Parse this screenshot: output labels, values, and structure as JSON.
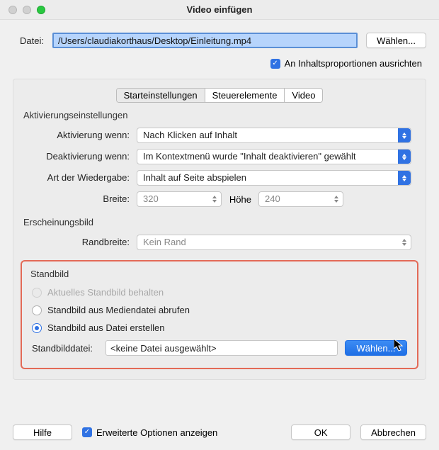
{
  "window": {
    "title": "Video einfügen"
  },
  "file": {
    "label": "Datei:",
    "path": "/Users/claudiakorthaus/Desktop/Einleitung.mp4",
    "choose": "Wählen..."
  },
  "aspect": {
    "label": "An Inhaltsproportionen ausrichten"
  },
  "tabs": {
    "t1": "Starteinstellungen",
    "t2": "Steuerelemente",
    "t3": "Video"
  },
  "activation": {
    "section": "Aktivierungseinstellungen",
    "activate": {
      "label": "Aktivierung wenn:",
      "value": "Nach Klicken auf Inhalt"
    },
    "deactivate": {
      "label": "Deaktivierung wenn:",
      "value": "Im Kontextmenü wurde \"Inhalt deaktivieren\" gewählt"
    },
    "playback": {
      "label": "Art der Wiedergabe:",
      "value": "Inhalt auf Seite abspielen"
    },
    "width": {
      "label": "Breite:",
      "value": "320"
    },
    "height": {
      "label": "Höhe",
      "value": "240"
    }
  },
  "appearance": {
    "section": "Erscheinungsbild",
    "border": {
      "label": "Randbreite:",
      "value": "Kein Rand"
    }
  },
  "poster": {
    "section": "Standbild",
    "opt1": "Aktuelles Standbild behalten",
    "opt2": "Standbild aus Mediendatei abrufen",
    "opt3": "Standbild aus Datei erstellen",
    "fileLabel": "Standbilddatei:",
    "fileValue": "<keine Datei ausgewählt>",
    "choose": "Wählen..."
  },
  "footer": {
    "help": "Hilfe",
    "extended": "Erweiterte Optionen anzeigen",
    "ok": "OK",
    "cancel": "Abbrechen"
  }
}
